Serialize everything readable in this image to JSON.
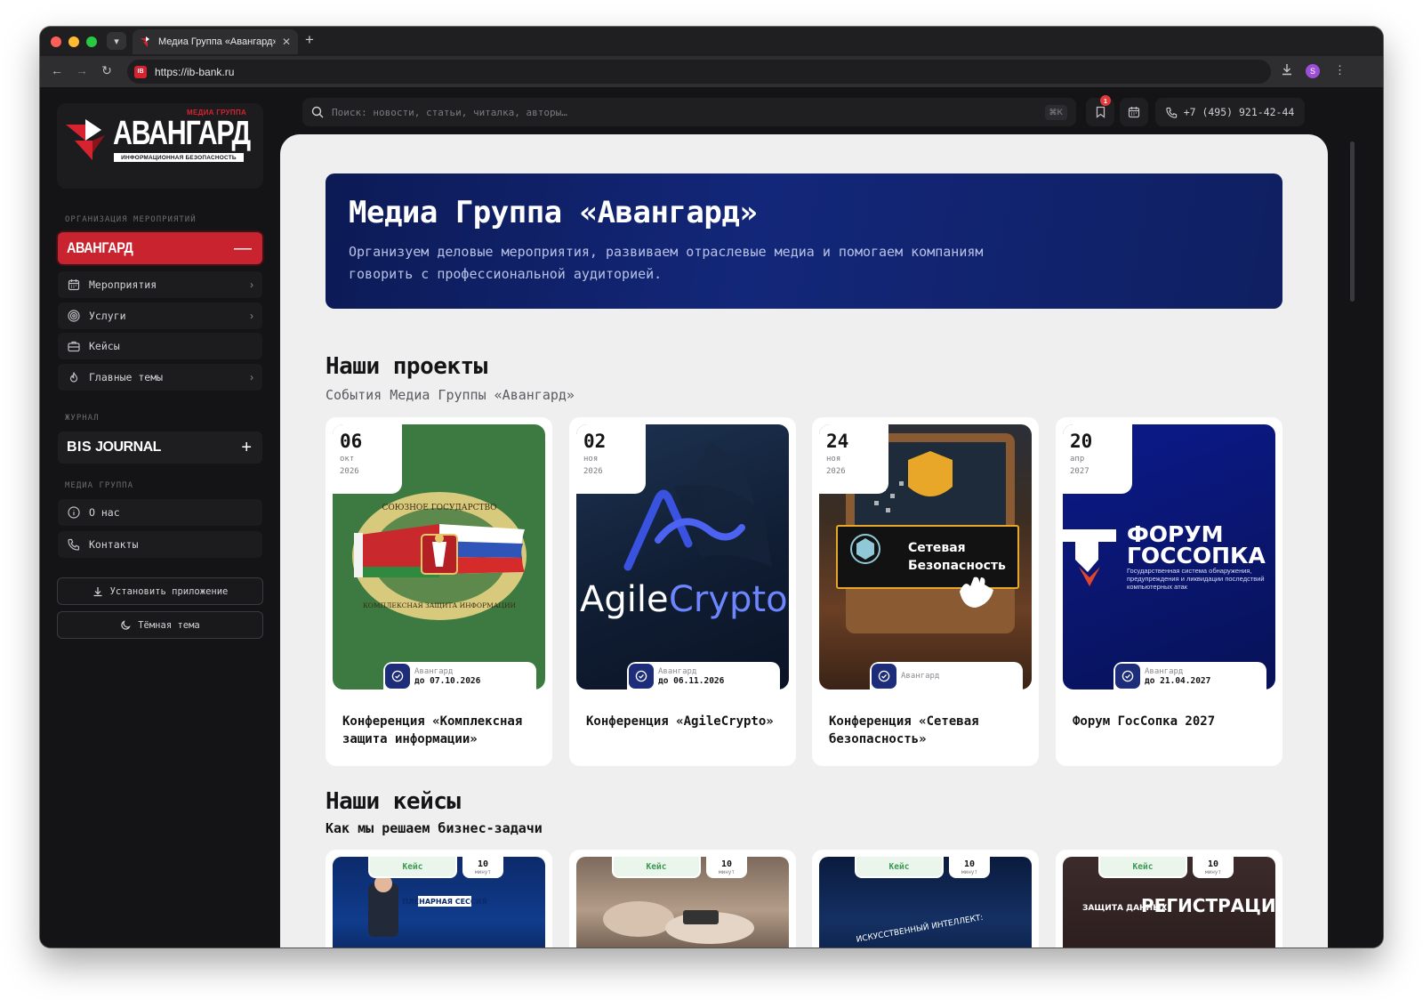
{
  "browser": {
    "tab_title": "Медиа Группа «Авангард»",
    "new_tab": "+",
    "url": "https://ib-bank.ru",
    "site_icon_text": "IB",
    "profile_initial": "S"
  },
  "logo": {
    "small": "МЕДИА ГРУППА",
    "name": "АВАНГАРД",
    "tagline": "ИНФОРМАЦИОННАЯ БЕЗОПАСНОСТЬ"
  },
  "sidebar": {
    "section_events": "ОРГАНИЗАЦИЯ МЕРОПРИЯТИЙ",
    "brand_avangard": "АВАНГАРД",
    "brand_avangard_ctrl": "—",
    "items_events": [
      {
        "label": "Мероприятия",
        "icon": "calendar-icon",
        "chevron": "›"
      },
      {
        "label": "Услуги",
        "icon": "target-icon",
        "chevron": "›"
      },
      {
        "label": "Кейсы",
        "icon": "briefcase-icon",
        "chevron": ""
      },
      {
        "label": "Главные темы",
        "icon": "flame-icon",
        "chevron": "›"
      }
    ],
    "section_journal": "ЖУРНАЛ",
    "brand_journal_bold": "BIS",
    "brand_journal_rest": " JOURNAL",
    "brand_journal_ctrl": "+",
    "section_media": "МЕДИА ГРУППА",
    "items_media": [
      {
        "label": "О нас",
        "icon": "info-icon"
      },
      {
        "label": "Контакты",
        "icon": "phone-icon"
      }
    ],
    "install_label": "Установить приложение",
    "theme_label": "Тёмная тема"
  },
  "topbar": {
    "search_placeholder": "Поиск: новости, статьи, читалка, авторы…",
    "search_shortcut": "⌘K",
    "bookmarks_badge": "1",
    "phone": "+7 (495) 921-42-44"
  },
  "hero": {
    "title": "Медиа Группа «Авангард»",
    "subtitle": "Организуем деловые мероприятия, развиваем отраслевые медиа и помогаем компаниям говорить с профессиональной аудиторией."
  },
  "projects": {
    "title": "Наши проекты",
    "subtitle": "События Медиа Группы «Авангард»",
    "items": [
      {
        "day": "06",
        "month": "окт",
        "year": "2026",
        "org": "Авангард",
        "until": "до 07.10.2026",
        "title": "Конференция «Комплексная защита информации»",
        "image_text_top": "СОЮЗНОЕ ГОСУДАРСТВО",
        "image_text_bottom": "КОМПЛЕКСНАЯ ЗАЩИТА ИНФОРМАЦИИ"
      },
      {
        "day": "02",
        "month": "ноя",
        "year": "2026",
        "org": "Авангард",
        "until": "до 06.11.2026",
        "title": "Конференция «AgileCrypto»",
        "image_text_a": "Agile",
        "image_text_b": "Crypto"
      },
      {
        "day": "24",
        "month": "ноя",
        "year": "2026",
        "org": "Авангард",
        "until": "",
        "title": "Конференция «Сетевая безопасность»",
        "image_text_1": "Сетевая",
        "image_text_2": "Безопасность"
      },
      {
        "day": "20",
        "month": "апр",
        "year": "2027",
        "org": "Авангард",
        "until": "до 21.04.2027",
        "title": "Форум ГосСопка 2027",
        "image_text_1": "ФОРУМ",
        "image_text_2": "ГОССОПКА",
        "image_text_3": "Государственная система обнаружения, предупреждения и ликвидации последствий компьютерных атак"
      }
    ]
  },
  "cases": {
    "title": "Наши кейсы",
    "subtitle": "Как мы решаем бизнес-задачи",
    "items": [
      {
        "tag": "Кейс",
        "minutes": "10",
        "unit": "минут",
        "image_text": "ПЛЕНАРНАЯ СЕССИЯ"
      },
      {
        "tag": "Кейс",
        "minutes": "10",
        "unit": "минут",
        "image_text": ""
      },
      {
        "tag": "Кейс",
        "minutes": "10",
        "unit": "минут",
        "image_text": "ИСКУССТВЕННЫЙ ИНТЕЛЛЕКТ:"
      },
      {
        "tag": "Кейс",
        "minutes": "10",
        "unit": "минут",
        "image_text": "РЕГИСТРАЦИЯ",
        "image_text_2": "ЗАЩИТА ДАННЫХ"
      }
    ]
  },
  "colors": {
    "accent_red": "#c8232e",
    "hero_blue": "#13277a",
    "case_green": "#3b9a52",
    "sidebar_bg": "#141416",
    "content_bg": "#efefef"
  }
}
